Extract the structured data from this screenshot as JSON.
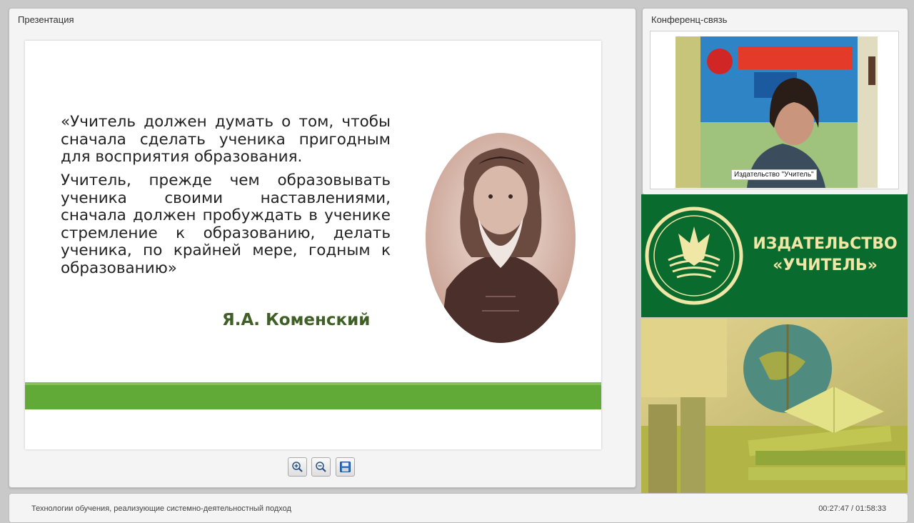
{
  "presentation": {
    "title": "Презентация",
    "slide": {
      "quote_paragraph_1": "«Учитель должен думать о том, чтобы сначала сделать ученика пригодным для восприятия образования.",
      "quote_paragraph_2": "Учитель, прежде чем образовывать ученика своими наставлениями, сначала должен пробуждать в ученике стремление к образованию, делать ученика, по крайней мере, годным к образованию»",
      "author": "Я.А. Коменский",
      "accent_color": "#62aa38"
    },
    "toolbar": {
      "zoom_in_icon": "zoom-in-icon",
      "zoom_out_icon": "zoom-out-icon",
      "save_icon": "save-icon"
    }
  },
  "conference": {
    "title": "Конференц-связь",
    "participant_label": "Издательство \"Учитель\""
  },
  "banner": {
    "logo_line_1": "ИЗДАТЕЛЬСТВО",
    "logo_line_2": "«УЧИТЕЛЬ»",
    "background_color": "#0a6b2e",
    "text_color": "#f0e7a6"
  },
  "footer": {
    "webinar_title": "Технологии обучения, реализующие системно-деятельностный подход",
    "time": "00:27:47 / 01:58:33"
  }
}
